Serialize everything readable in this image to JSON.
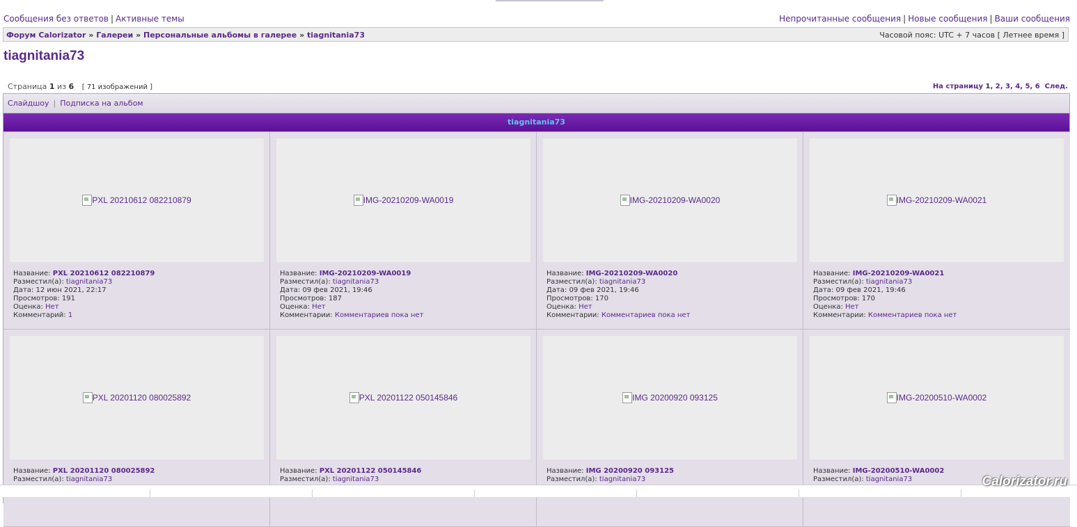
{
  "top_links": {
    "left": [
      "Сообщения без ответов",
      "Активные темы"
    ],
    "right": [
      "Непрочитанные сообщения",
      "Новые сообщения",
      "Ваши сообщения"
    ]
  },
  "breadcrumb": {
    "items": [
      "Форум Calorizator",
      "Галереи",
      "Персональные альбомы в галерее",
      "tiagnitania73"
    ],
    "separator": "»",
    "timezone": "Часовой пояс: UTC + 7 часов [ Летнее время ]"
  },
  "page_title": "tiagnitania73",
  "pagination": {
    "page_word": "Страница",
    "current": "1",
    "of_word": "из",
    "total": "6",
    "count": "[ 71 изображений ]",
    "goto_label": "На страницу",
    "pages": [
      "1",
      "2",
      "3",
      "4",
      "5",
      "6"
    ],
    "next_label": "След."
  },
  "toolbar": {
    "slideshow": "Слайдшоу",
    "subscribe": "Подписка на альбом"
  },
  "album_header": "tiagnitania73",
  "labels": {
    "name": "Название:",
    "posted_by": "Разместил(а):",
    "date": "Дата:",
    "views": "Просмотров:",
    "rating": "Оценка:",
    "comments_one": "Комментарий:",
    "comments_many": "Комментарии:"
  },
  "images": [
    {
      "alt": "PXL 20210612 082210879",
      "title": "PXL 20210612 082210879",
      "author": "tiagnitania73",
      "date": "12 июн 2021, 22:17",
      "views": "191",
      "rating": "Нет",
      "comments_label": "Комментарий:",
      "comments": "1"
    },
    {
      "alt": "IMG-20210209-WA0019",
      "title": "IMG-20210209-WA0019",
      "author": "tiagnitania73",
      "date": "09 фев 2021, 19:46",
      "views": "187",
      "rating": "Нет",
      "comments_label": "Комментарии:",
      "comments": "Комментариев пока нет"
    },
    {
      "alt": "IMG-20210209-WA0020",
      "title": "IMG-20210209-WA0020",
      "author": "tiagnitania73",
      "date": "09 фев 2021, 19:46",
      "views": "170",
      "rating": "Нет",
      "comments_label": "Комментарии:",
      "comments": "Комментариев пока нет"
    },
    {
      "alt": "IMG-20210209-WA0021",
      "title": "IMG-20210209-WA0021",
      "author": "tiagnitania73",
      "date": "09 фев 2021, 19:46",
      "views": "170",
      "rating": "Нет",
      "comments_label": "Комментарии:",
      "comments": "Комментариев пока нет"
    },
    {
      "alt": "PXL 20201120 080025892",
      "title": "PXL 20201120 080025892",
      "author": "tiagnitania73"
    },
    {
      "alt": "PXL 20201122 050145846",
      "title": "PXL 20201122 050145846",
      "author": "tiagnitania73"
    },
    {
      "alt": "IMG 20200920 093125",
      "title": "IMG 20200920 093125",
      "author": "tiagnitania73"
    },
    {
      "alt": "IMG-20200510-WA0002",
      "title": "IMG-20200510-WA0002",
      "author": "tiagnitania73"
    }
  ],
  "watermark": "Calorizator.ru",
  "colors": {
    "link": "#5a2a8a",
    "header_bg": "#6a1aa6",
    "header_text": "#5ec4f2",
    "cell_bg": "#e3dee8"
  }
}
